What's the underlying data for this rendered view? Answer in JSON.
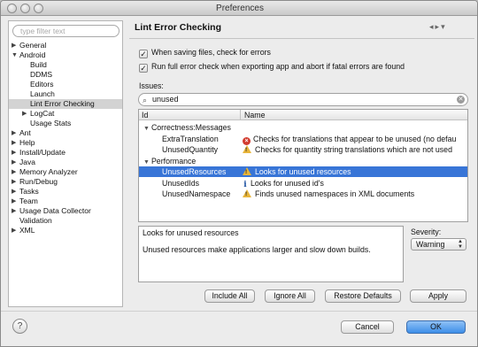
{
  "window": {
    "title": "Preferences"
  },
  "left": {
    "filter_placeholder": "type filter text",
    "tree": [
      {
        "label": "General",
        "expander": "▶",
        "indent": 0
      },
      {
        "label": "Android",
        "expander": "▼",
        "indent": 0
      },
      {
        "label": "Build",
        "expander": "",
        "indent": 1
      },
      {
        "label": "DDMS",
        "expander": "",
        "indent": 1
      },
      {
        "label": "Editors",
        "expander": "",
        "indent": 1
      },
      {
        "label": "Launch",
        "expander": "",
        "indent": 1
      },
      {
        "label": "Lint Error Checking",
        "expander": "",
        "indent": 1,
        "selected": true
      },
      {
        "label": "LogCat",
        "expander": "▶",
        "indent": 1
      },
      {
        "label": "Usage Stats",
        "expander": "",
        "indent": 1
      },
      {
        "label": "Ant",
        "expander": "▶",
        "indent": 0
      },
      {
        "label": "Help",
        "expander": "▶",
        "indent": 0
      },
      {
        "label": "Install/Update",
        "expander": "▶",
        "indent": 0
      },
      {
        "label": "Java",
        "expander": "▶",
        "indent": 0
      },
      {
        "label": "Memory Analyzer",
        "expander": "▶",
        "indent": 0
      },
      {
        "label": "Run/Debug",
        "expander": "▶",
        "indent": 0
      },
      {
        "label": "Tasks",
        "expander": "▶",
        "indent": 0
      },
      {
        "label": "Team",
        "expander": "▶",
        "indent": 0
      },
      {
        "label": "Usage Data Collector",
        "expander": "▶",
        "indent": 0
      },
      {
        "label": "Validation",
        "expander": "",
        "indent": 0
      },
      {
        "label": "XML",
        "expander": "▶",
        "indent": 0
      }
    ]
  },
  "main": {
    "title": "Lint Error Checking",
    "nav_icons": [
      "back-arrow-icon",
      "forward-arrow-icon",
      "menu-dropdown-icon"
    ],
    "checks": [
      {
        "label": "When saving files, check for errors",
        "checked": true
      },
      {
        "label": "Run full error check when exporting app and abort if fatal errors are found",
        "checked": true
      }
    ],
    "issues_label": "Issues:",
    "search_value": "unused",
    "table": {
      "headers": {
        "id": "Id",
        "name": "Name"
      },
      "rows": [
        {
          "id": "Correctness:Messages",
          "name": "",
          "kind": "category",
          "icon": ""
        },
        {
          "id": "ExtraTranslation",
          "name": "Checks for translations that appear to be unused (no defau",
          "kind": "issue",
          "icon": "error"
        },
        {
          "id": "UnusedQuantity",
          "name": "Checks for quantity string translations which are not used",
          "kind": "issue",
          "icon": "warning"
        },
        {
          "id": "Performance",
          "name": "",
          "kind": "category",
          "icon": ""
        },
        {
          "id": "UnusedResources",
          "name": "Looks for unused resources",
          "kind": "issue",
          "icon": "warning",
          "selected": true
        },
        {
          "id": "UnusedIds",
          "name": "Looks for unused id's",
          "kind": "issue",
          "icon": "info"
        },
        {
          "id": "UnusedNamespace",
          "name": "Finds unused namespaces in XML documents",
          "kind": "issue",
          "icon": "warning"
        }
      ]
    },
    "description": {
      "title": "Looks for unused resources",
      "body": "Unused resources make applications larger and slow down builds."
    },
    "severity": {
      "label": "Severity:",
      "value": "Warning"
    },
    "buttons": {
      "include_all": "Include All",
      "ignore_all": "Ignore All",
      "restore_defaults": "Restore Defaults",
      "apply": "Apply"
    }
  },
  "footer": {
    "cancel": "Cancel",
    "ok": "OK",
    "help": "?"
  }
}
